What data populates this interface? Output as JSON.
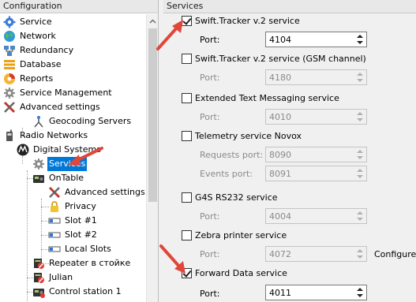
{
  "left": {
    "header": "Configuration",
    "tree": [
      {
        "label": "Service",
        "icon": "gear-blue-icon",
        "level": 0
      },
      {
        "label": "Network",
        "icon": "globe-icon",
        "level": 0
      },
      {
        "label": "Redundancy",
        "icon": "network-icon",
        "level": 0
      },
      {
        "label": "Database",
        "icon": "database-icon",
        "level": 0
      },
      {
        "label": "Reports",
        "icon": "reports-icon",
        "level": 0
      },
      {
        "label": "Service Management",
        "icon": "gear-gray-icon",
        "level": 0
      },
      {
        "label": "Advanced settings",
        "icon": "tools-icon",
        "level": 0,
        "expanded": true
      },
      {
        "label": "Geocoding Servers",
        "icon": "geocoding-icon",
        "level": 1
      },
      {
        "label": "Radio Networks",
        "icon": "radio-icon",
        "level": 0,
        "expanded": true
      },
      {
        "label": "Digital Systems",
        "icon": "motorola-icon",
        "level": 1,
        "expanded": true
      },
      {
        "label": "Services",
        "icon": "gear-gray-icon",
        "level": 2,
        "selected": true
      },
      {
        "label": "OnTable",
        "icon": "radio-device-icon",
        "level": 2,
        "expanded": true
      },
      {
        "label": "Advanced settings",
        "icon": "tools-icon",
        "level": 3
      },
      {
        "label": "Privacy",
        "icon": "lock-icon",
        "level": 3
      },
      {
        "label": "Slot #1",
        "icon": "slot-icon",
        "level": 3
      },
      {
        "label": "Slot #2",
        "icon": "slot-icon",
        "level": 3
      },
      {
        "label": "Local Slots",
        "icon": "slot-icon",
        "level": 3
      },
      {
        "label": "Repeater в стойке",
        "icon": "repeater-icon",
        "level": 2
      },
      {
        "label": "Julian",
        "icon": "repeater-icon",
        "level": 2
      },
      {
        "label": "Control station 1",
        "icon": "radio-device-icon",
        "level": 2
      }
    ]
  },
  "right": {
    "header": "Services",
    "services": [
      {
        "label": "Swift.Tracker v.2 service",
        "checked": true,
        "fields": [
          {
            "label": "Port:",
            "value": "4104",
            "enabled": true
          }
        ]
      },
      {
        "label": "Swift.Tracker v.2 service (GSM channel)",
        "checked": false,
        "fields": [
          {
            "label": "Port:",
            "value": "4180",
            "enabled": false
          }
        ]
      },
      {
        "label": "Extended Text Messaging service",
        "checked": false,
        "fields": [
          {
            "label": "Port:",
            "value": "4010",
            "enabled": false
          }
        ]
      },
      {
        "label": "Telemetry service Novox",
        "checked": false,
        "fields": [
          {
            "label": "Requests port:",
            "value": "8090",
            "enabled": false
          },
          {
            "label": "Events port:",
            "value": "8091",
            "enabled": false
          }
        ]
      },
      {
        "label": "G4S RS232 service",
        "checked": false,
        "fields": [
          {
            "label": "Port:",
            "value": "4004",
            "enabled": false
          }
        ]
      },
      {
        "label": "Zebra printer service",
        "checked": false,
        "fields": [
          {
            "label": "Port:",
            "value": "4072",
            "enabled": false
          }
        ],
        "link": "Configure"
      },
      {
        "label": "Forward Data service",
        "checked": true,
        "fields": [
          {
            "label": "Port:",
            "value": "4011",
            "enabled": true
          }
        ]
      }
    ]
  },
  "colors": {
    "selection": "#0078d7",
    "annotation_arrow": "#e0473a"
  }
}
